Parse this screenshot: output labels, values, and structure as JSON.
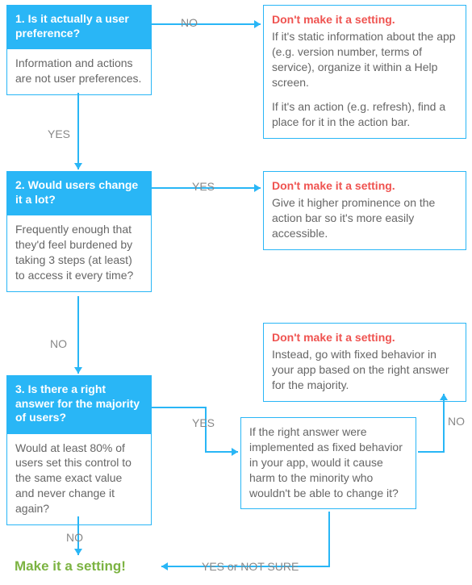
{
  "chart_data": {
    "type": "flowchart",
    "nodes": [
      {
        "id": "q1",
        "kind": "decision",
        "title": "1. Is it actually a user preference?",
        "body": "Information and actions are not user preferences."
      },
      {
        "id": "o1",
        "kind": "outcome",
        "warn": "Don't make it a setting.",
        "body": "If it's static information about the app (e.g. version number, terms of service), organize it within a Help screen.\n\nIf it's an action (e.g. refresh), find a place for it in the action bar."
      },
      {
        "id": "q2",
        "kind": "decision",
        "title": "2. Would users change it a lot?",
        "body": "Frequently enough that they'd feel burdened by taking 3 steps (at least) to access it every time?"
      },
      {
        "id": "o2",
        "kind": "outcome",
        "warn": "Don't make it a setting.",
        "body": "Give it higher prominence on the action bar so it's more easily accessible."
      },
      {
        "id": "o3",
        "kind": "outcome",
        "warn": "Don't make it a setting.",
        "body": "Instead, go with fixed behavior in your app based on the right answer for the majority."
      },
      {
        "id": "q3",
        "kind": "decision",
        "title": "3. Is there a right answer for the majority of users?",
        "body": "Would at least 80% of users set this control to the same exact value and never change it again?"
      },
      {
        "id": "harm",
        "kind": "sub",
        "body": "If the right answer were implemented as fixed behavior in your app, would it cause harm to the minority who wouldn't be able to change it?"
      },
      {
        "id": "final",
        "kind": "final",
        "label": "Make it a setting!"
      }
    ],
    "edges": [
      {
        "from": "q1",
        "to": "o1",
        "label": "NO"
      },
      {
        "from": "q1",
        "to": "q2",
        "label": "YES"
      },
      {
        "from": "q2",
        "to": "o2",
        "label": "YES"
      },
      {
        "from": "q2",
        "to": "q3",
        "label": "NO"
      },
      {
        "from": "q3",
        "to": "harm",
        "label": "YES"
      },
      {
        "from": "q3",
        "to": "final",
        "label": "NO"
      },
      {
        "from": "harm",
        "to": "o3",
        "label": "NO"
      },
      {
        "from": "harm",
        "to": "final",
        "label": "YES or NOT SURE"
      }
    ]
  },
  "q1": {
    "title": "1. Is it actually a user preference?",
    "body": "Information and actions are not user preferences."
  },
  "o1": {
    "warn": "Don't make it a setting.",
    "l1": "If it's static information about the app (e.g. version number, terms of service), organize it within a Help screen.",
    "l2": "If it's an action (e.g. refresh), find a place for it in the action bar."
  },
  "q2": {
    "title": "2. Would users change it a lot?",
    "body": "Frequently enough that they'd feel burdened by taking 3 steps (at least) to access it every time?"
  },
  "o2": {
    "warn": "Don't make it a setting.",
    "body": "Give it higher prominence on the action bar so it's more easily accessible."
  },
  "o3": {
    "warn": "Don't make it a setting.",
    "body": "Instead, go with fixed behavior in your app based on the right answer for the majority."
  },
  "q3": {
    "title": "3. Is there a right answer for the majority of users?",
    "body": "Would at least 80% of users set this control to the same exact value and never change it again?"
  },
  "harm": {
    "body": "If the right answer were implemented as fixed behavior in your app, would it cause harm to the minority who wouldn't be able to change it?"
  },
  "final": {
    "label": "Make it a setting!"
  },
  "labels": {
    "no": "NO",
    "yes": "YES",
    "yesnotsure": "YES or NOT SURE"
  }
}
